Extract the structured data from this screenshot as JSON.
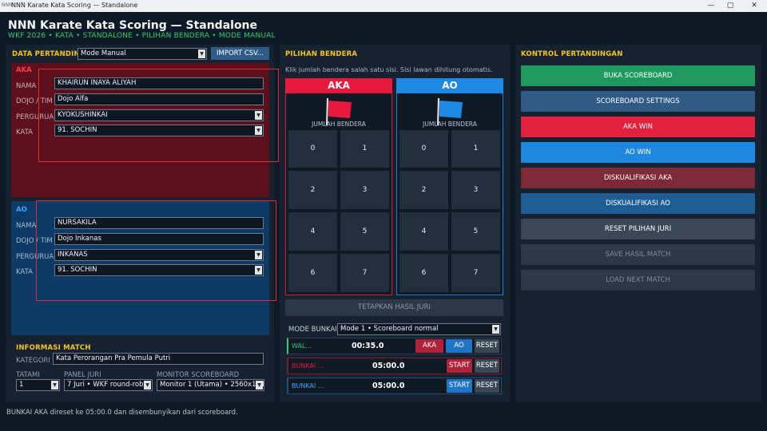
{
  "window": {
    "title": "NNN Karate Kata Scoring — Standalone",
    "icon": "NNN",
    "controls": [
      "—",
      "▢",
      "✕"
    ]
  },
  "header": {
    "title": "NNN Karate Kata Scoring — Standalone",
    "subtitle": "WKF 2026 • KATA • STANDALONE • PILIHAN BENDERA • MODE MANUAL"
  },
  "data_pertandingan": {
    "section_label": "DATA PERTANDINGAN",
    "mode_select": "Mode Manual",
    "import_button": "IMPORT CSV...",
    "aka": {
      "label": "AKA",
      "nama_label": "NAMA",
      "nama": "KHAIRUN INAYA ALIYAH",
      "dojo_label": "DOJO / TIM",
      "dojo": "Dojo Alfa",
      "perguruan_label": "PERGURUAN",
      "perguruan": "KYOKUSHINKAI",
      "kata_label": "KATA",
      "kata": "91. SOCHIN"
    },
    "ao": {
      "label": "AO",
      "nama_label": "NAMA",
      "nama": "NURSAKILA",
      "dojo_label": "DOJO / TIM",
      "dojo": "Dojo Inkanas",
      "perguruan_label": "PERGURUAN",
      "perguruan": "INKANAS",
      "kata_label": "KATA",
      "kata": "91. SOCHIN"
    }
  },
  "informasi_match": {
    "section_label": "INFORMASI MATCH",
    "kategori_label": "KATEGORI",
    "kategori": "Kata Perorangan Pra Pemula Putri",
    "tatami_label": "TATAMI",
    "tatami": "1",
    "panel_juri_label": "PANEL JURI",
    "panel_juri": "7 Juri • WKF round-robin",
    "monitor_label": "MONITOR SCOREBOARD",
    "monitor": "Monitor 1 (Utama) • 2560x1440"
  },
  "pilihan_bendera": {
    "section_label": "PILIHAN BENDERA",
    "hint": "Klik jumlah bendera salah satu sisi. Sisi lawan dihitung otomatis.",
    "aka_header": "AKA",
    "ao_header": "AO",
    "jumlah_label": "JUMLAH BENDERA",
    "numbers": [
      "0",
      "1",
      "2",
      "3",
      "4",
      "5",
      "6",
      "7"
    ],
    "tetapkan_button": "TETAPKAN HASIL JURI",
    "aka_color": "#e8193c",
    "ao_color": "#1e88e5"
  },
  "timers": {
    "mode_label": "MODE BUNKAI",
    "mode_value": "Mode 1 • Scoreboard normal",
    "rows": [
      {
        "label": "WAL...",
        "time": "00:35.0",
        "btn1": "AKA",
        "btn2": "AO",
        "btn3": "RESET"
      },
      {
        "label": "BUNKAI ...",
        "time": "05:00.0",
        "btn1": "START",
        "btn2": "RESET"
      },
      {
        "label": "BUNKAI ...",
        "time": "05:00.0",
        "btn1": "START",
        "btn2": "RESET"
      }
    ]
  },
  "kontrol": {
    "section_label": "KONTROL PERTANDINGAN",
    "buttons": [
      {
        "label": "BUKA SCOREBOARD",
        "color": "#1f9a5e"
      },
      {
        "label": "SCOREBOARD SETTINGS",
        "color": "#2f5b86"
      },
      {
        "label": "AKA WIN",
        "color": "#e2213f"
      },
      {
        "label": "AO WIN",
        "color": "#1e87e0"
      },
      {
        "label": "DISKUALIFIKASI AKA",
        "color": "#7e2a36"
      },
      {
        "label": "DISKUALIFIKASI AO",
        "color": "#1f5d95"
      },
      {
        "label": "RESET PILIHAN JURI",
        "color": "#3a4856"
      },
      {
        "label": "SAVE HASIL MATCH",
        "color": "#2c3846"
      },
      {
        "label": "LOAD NEXT MATCH",
        "color": "#2c3846"
      }
    ]
  },
  "status": {
    "text": "BUNKAI AKA direset ke 05:00.0 dan disembunyikan dari scoreboard."
  }
}
